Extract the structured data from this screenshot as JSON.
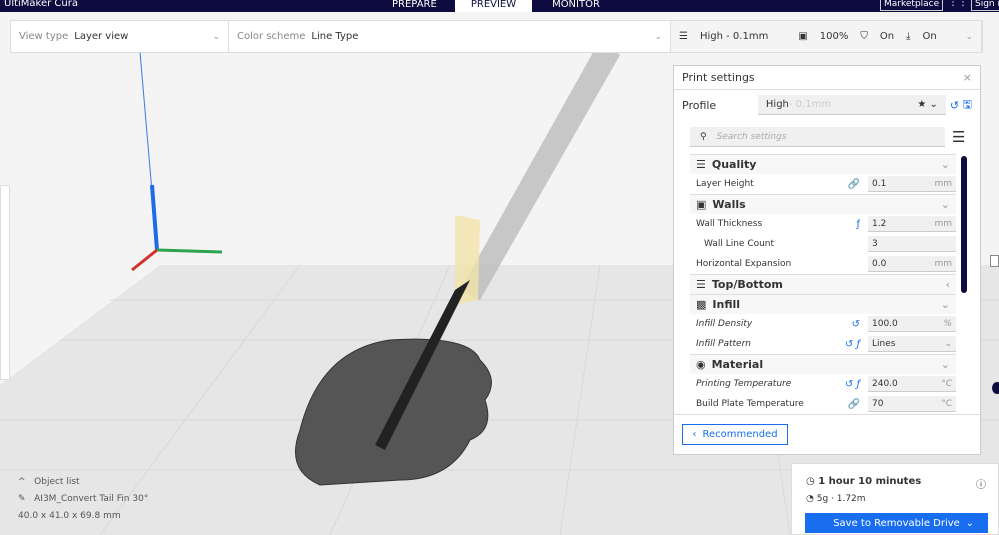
{
  "app": {
    "title": "UltiMaker Cura",
    "stages": [
      "PREPARE",
      "PREVIEW",
      "MONITOR"
    ],
    "active_stage": "PREVIEW",
    "marketplace": "Marketplace",
    "sign_in": "Sign in"
  },
  "toolbar": {
    "view_type_label": "View type",
    "view_type": "Layer view",
    "color_scheme_label": "Color scheme",
    "color_scheme": "Line Type",
    "profile": "High - 0.1mm",
    "infill": "100%",
    "support": "On",
    "adhesion": "On"
  },
  "panel": {
    "title": "Print settings",
    "profile_label": "Profile",
    "profile_name": "High",
    "profile_suffix": " - 0.1mm",
    "search_placeholder": "Search settings",
    "categories": [
      {
        "name": "Quality",
        "rows": [
          {
            "label": "Layer Height",
            "icons": "🔗",
            "value": "0.1",
            "unit": "mm"
          }
        ]
      },
      {
        "name": "Walls",
        "rows": [
          {
            "label": "Wall Thickness",
            "icons": "ƒ",
            "value": "1.2",
            "unit": "mm"
          },
          {
            "label": "Wall Line Count",
            "icons": "",
            "value": "3",
            "unit": "",
            "indent": true
          },
          {
            "label": "Horizontal Expansion",
            "icons": "",
            "value": "0.0",
            "unit": "mm"
          }
        ]
      },
      {
        "name": "Top/Bottom",
        "rows": []
      },
      {
        "name": "Infill",
        "rows": [
          {
            "label": "Infill Density",
            "icons": "↺",
            "value": "100.0",
            "unit": "%",
            "italic": true
          },
          {
            "label": "Infill Pattern",
            "icons": "↺ ƒ",
            "value": "Lines",
            "unit": "⌄",
            "italic": true
          }
        ]
      },
      {
        "name": "Material",
        "rows": [
          {
            "label": "Printing Temperature",
            "icons": "↺ ƒ",
            "value": "240.0",
            "unit": "°C",
            "italic": true
          },
          {
            "label": "Build Plate Temperature",
            "icons": "🔗",
            "value": "70",
            "unit": "°C"
          }
        ]
      }
    ],
    "recommended": "Recommended"
  },
  "print": {
    "time": "1 hour 10 minutes",
    "material": "5g · 1.72m",
    "save": "Save to Removable Drive"
  },
  "objects": {
    "header": "Object list",
    "name": "AI3M_Convert Tail Fin 30°",
    "dims": "40.0 x 41.0 x 69.8 mm"
  },
  "colors": {
    "navy": "#0d0b3f",
    "accent": "#196ef0"
  }
}
